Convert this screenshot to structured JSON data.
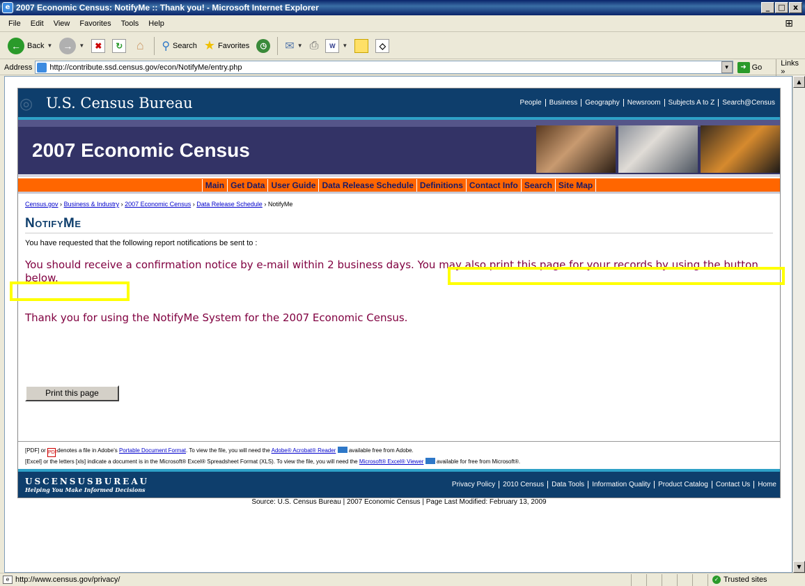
{
  "window": {
    "title": "2007 Economic Census: NotifyMe :: Thank you! - Microsoft Internet Explorer",
    "controls": [
      "_",
      "□",
      "x"
    ]
  },
  "menu": [
    "File",
    "Edit",
    "View",
    "Favorites",
    "Tools",
    "Help"
  ],
  "toolbar": {
    "back_label": "Back",
    "search_label": "Search",
    "favorites_label": "Favorites"
  },
  "address": {
    "label": "Address",
    "url": "http://contribute.ssd.census.gov/econ/NotifyMe/entry.php",
    "go_label": "Go",
    "links_label": "Links"
  },
  "site": {
    "bureau_name": "U.S. Census Bureau",
    "top_nav": [
      "People",
      "Business",
      "Geography",
      "Newsroom",
      "Subjects A to Z",
      "Search@Census"
    ],
    "banner_title": "2007 Economic Census",
    "main_nav": [
      "Main",
      "Get Data",
      "User Guide",
      "Data Release Schedule",
      "Definitions",
      "Contact Info",
      "Search",
      "Site Map"
    ]
  },
  "breadcrumb": {
    "items": [
      "Census.gov",
      "Business & Industry",
      "2007 Economic Census",
      "Data Release Schedule"
    ],
    "separator": "›",
    "current": "NotifyMe"
  },
  "content": {
    "page_title": "NotifyMe",
    "intro": "You have requested that the following report notifications be sent to :",
    "message": "You should receive a confirmation notice by e-mail within 2 business days. You may also print this page for your records by using the button below.",
    "thanks": "Thank you for using the NotifyMe System for the 2007 Economic Census.",
    "print_button": "Print this page"
  },
  "footnotes": {
    "pdf_prefix": "[PDF] or",
    "pdf_icon_label": "PDF",
    "pdf_text1": "denotes a file in Adobe's",
    "pdf_link1": "Portable Document Format",
    "pdf_text2": ". To view the file, you will need the",
    "pdf_link2": "Adobe® Acrobat® Reader",
    "pdf_text3": "available free from Adobe.",
    "excel_text1": "[Excel] or the letters [xls] indicate a document is in the Microsoft® Excel® Spreadsheet Format (XLS). To view the file, you will need the",
    "excel_link": "Microsoft® Excel® Viewer",
    "excel_text2": "available for free from Microsoft®."
  },
  "footer": {
    "logo_line1": "USCENSUSBUREAU",
    "logo_line2": "Helping You Make Informed Decisions",
    "nav": [
      "Privacy Policy",
      "2010 Census",
      "Data Tools",
      "Information Quality",
      "Product Catalog",
      "Contact Us",
      "Home"
    ],
    "source": "Source: U.S. Census Bureau | 2007 Economic Census | Page Last Modified: February 13, 2009"
  },
  "status": {
    "url": "http://www.census.gov/privacy/",
    "zone": "Trusted sites"
  },
  "colors": {
    "header_blue": "#0e3e6c",
    "nav_orange": "#ff6600",
    "message_text": "#800040",
    "highlight": "#ffff00"
  }
}
